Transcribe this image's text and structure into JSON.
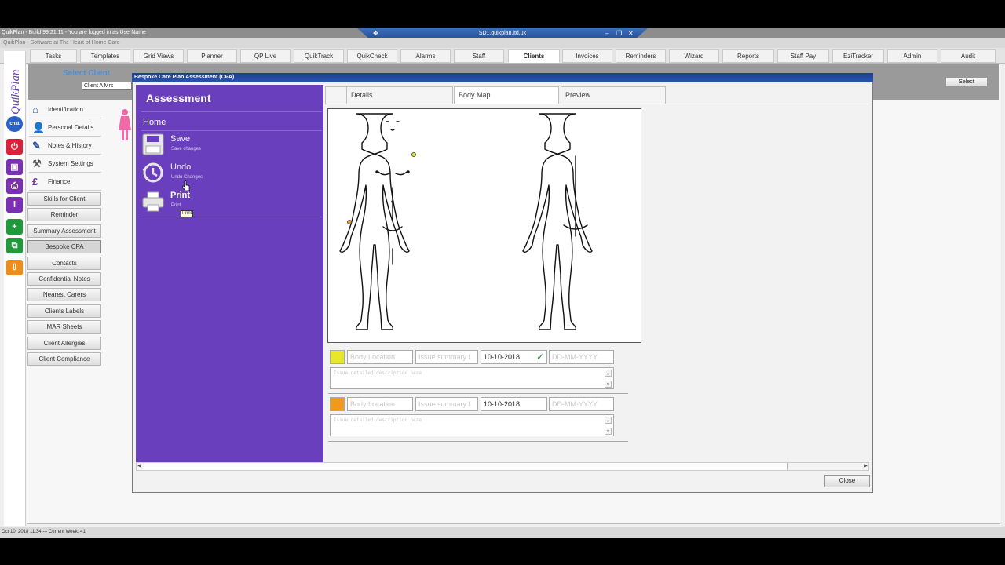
{
  "window": {
    "title": "QuikPlan - Build 99.21.11    - You are logged in as UserName",
    "remote_host": "SD1.quikplan.ltd.uk",
    "subtitle": "QuikPlan - Software at The Heart of Home Care",
    "status": "Oct 10, 2018 11:34   ---   Current Week: 41"
  },
  "menu": [
    "Tasks",
    "Templates",
    "Grid Views",
    "Planner",
    "QP Live",
    "QuikTrack",
    "QuikCheck",
    "Alarms",
    "Staff",
    "Clients",
    "Invoices",
    "Reminders",
    "Wizard",
    "Reports",
    "Staff Pay",
    "EziTracker",
    "Admin",
    "Audit"
  ],
  "menu_active": "Clients",
  "logo": "QuikPlan",
  "chat_label": "chat",
  "client_header": {
    "select_client": "Select Client",
    "client_field": "Client   A   Mrs",
    "select_button": "Select"
  },
  "nav_top": [
    "Identification",
    "Personal Details",
    "Notes & History",
    "System Settings",
    "Finance"
  ],
  "nav_buttons": [
    "Skills for Client",
    "Reminder",
    "Summary Assessment",
    "Bespoke CPA",
    "Contacts",
    "Confidential Notes",
    "Nearest Carers",
    "Clients Labels",
    "MAR Sheets",
    "Client Allergies",
    "Client Compliance"
  ],
  "nav_active": "Bespoke CPA",
  "modal": {
    "title": "Bespoke Care Plan Assessment (CPA)",
    "panel_title": "Assessment",
    "home": "Home",
    "actions": [
      {
        "title": "Save",
        "sub": "Save changes"
      },
      {
        "title": "Undo",
        "sub": "Undo Changes"
      },
      {
        "title": "Print",
        "sub": "Print"
      }
    ],
    "tooltip": "Print",
    "tabs": [
      "Details",
      "Body Map",
      "Preview"
    ],
    "active_tab": "Body Map",
    "close_button": "Close"
  },
  "issues": [
    {
      "color": "#e8e82a",
      "location_placeholder": "Body Location",
      "summary_placeholder": "Issue summary f",
      "date": "10-10-2018",
      "date2_placeholder": "DD-MM-YYYY",
      "desc_placeholder": "Issue detailed description here",
      "check": "✓"
    },
    {
      "color": "#ef9a1a",
      "location_placeholder": "Body Location",
      "summary_placeholder": "Issue summary f",
      "date": "10-10-2018",
      "date2_placeholder": "DD-MM-YYYY",
      "desc_placeholder": "Issue detailed description here"
    }
  ]
}
